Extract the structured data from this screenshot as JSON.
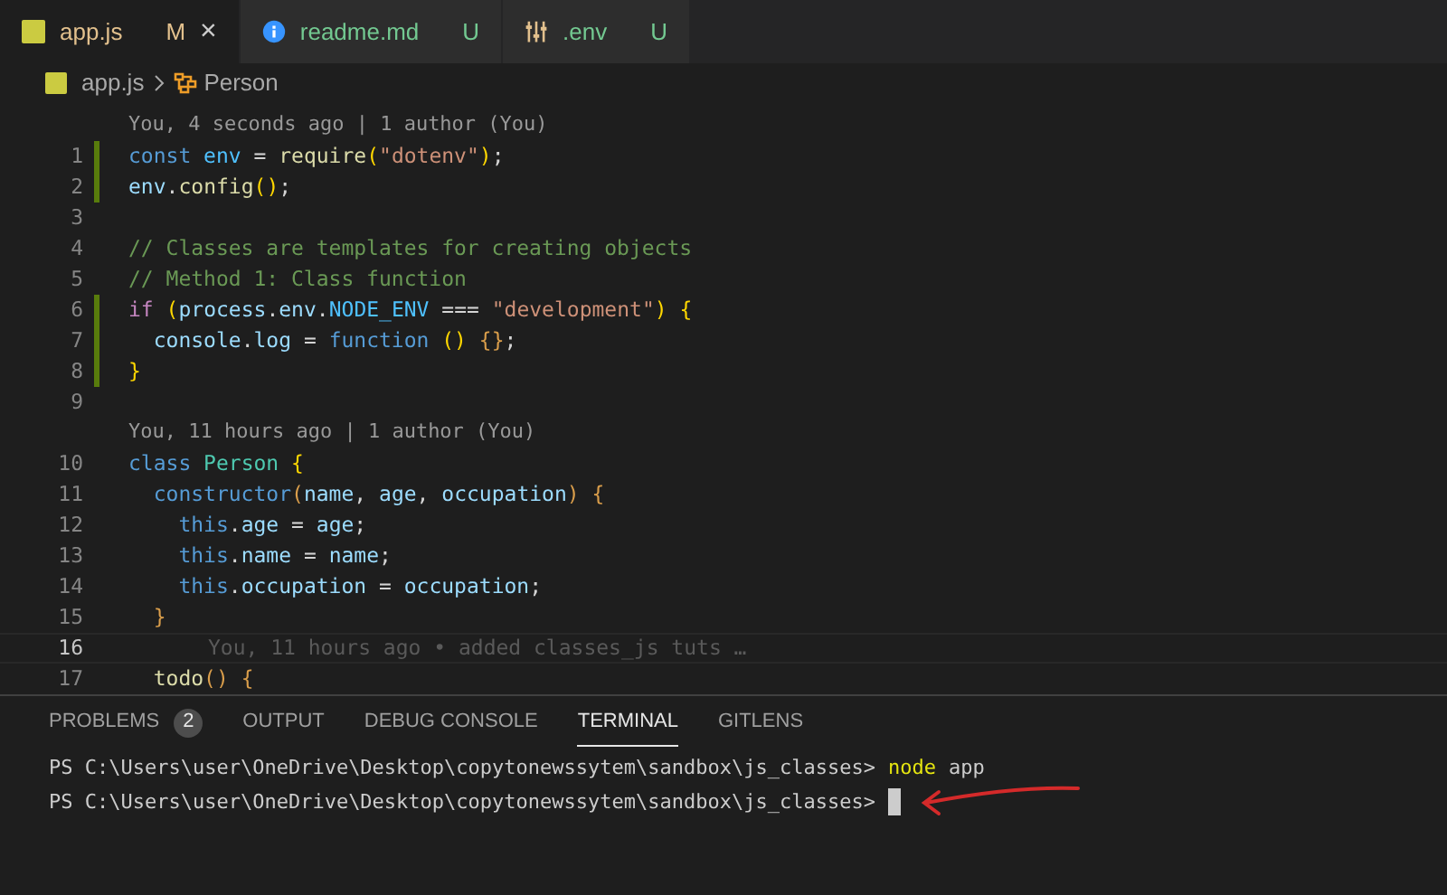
{
  "tabs": [
    {
      "label": "app.js",
      "status": "M",
      "kind": "js",
      "selected": true,
      "close": "×"
    },
    {
      "label": "readme.md",
      "status": "U",
      "kind": "info",
      "selected": false
    },
    {
      "label": ".env",
      "status": "U",
      "kind": "sliders",
      "selected": false
    }
  ],
  "breadcrumb": {
    "file": "app.js",
    "symbol": "Person"
  },
  "editor": {
    "rows": [
      {
        "kind": "codelens",
        "text": "You, 4 seconds ago | 1 author (You)"
      },
      {
        "kind": "code",
        "number": "1",
        "changed": true,
        "current": false,
        "tokens": [
          {
            "t": "const ",
            "kind": "keyword"
          },
          {
            "t": "env",
            "kind": "const"
          },
          {
            "t": " = ",
            "kind": "plain"
          },
          {
            "t": "require",
            "kind": "func"
          },
          {
            "t": "(",
            "kind": "bracket"
          },
          {
            "t": "\"dotenv\"",
            "kind": "string"
          },
          {
            "t": ")",
            "kind": "bracket"
          },
          {
            "t": ";",
            "kind": "plain"
          }
        ]
      },
      {
        "kind": "code",
        "number": "2",
        "changed": true,
        "current": false,
        "tokens": [
          {
            "t": "env",
            "kind": "var"
          },
          {
            "t": ".",
            "kind": "plain"
          },
          {
            "t": "config",
            "kind": "func"
          },
          {
            "t": "()",
            "kind": "bracket"
          },
          {
            "t": ";",
            "kind": "plain"
          }
        ]
      },
      {
        "kind": "code",
        "number": "3",
        "changed": false,
        "current": false,
        "tokens": []
      },
      {
        "kind": "code",
        "number": "4",
        "changed": false,
        "current": false,
        "tokens": [
          {
            "t": "// Classes are templates for creating objects",
            "kind": "comment"
          }
        ]
      },
      {
        "kind": "code",
        "number": "5",
        "changed": false,
        "current": false,
        "tokens": [
          {
            "t": "// Method 1: Class function",
            "kind": "comment"
          }
        ]
      },
      {
        "kind": "code",
        "number": "6",
        "changed": true,
        "current": false,
        "tokens": [
          {
            "t": "if ",
            "kind": "control"
          },
          {
            "t": "(",
            "kind": "bracket"
          },
          {
            "t": "process",
            "kind": "var"
          },
          {
            "t": ".",
            "kind": "plain"
          },
          {
            "t": "env",
            "kind": "var"
          },
          {
            "t": ".",
            "kind": "plain"
          },
          {
            "t": "NODE_ENV",
            "kind": "const"
          },
          {
            "t": " === ",
            "kind": "plain"
          },
          {
            "t": "\"development\"",
            "kind": "string"
          },
          {
            "t": ")",
            "kind": "bracket"
          },
          {
            "t": " {",
            "kind": "bracket"
          }
        ]
      },
      {
        "kind": "code",
        "number": "7",
        "changed": true,
        "current": false,
        "tokens": [
          {
            "t": "  console",
            "kind": "var"
          },
          {
            "t": ".",
            "kind": "plain"
          },
          {
            "t": "log",
            "kind": "var"
          },
          {
            "t": " = ",
            "kind": "plain"
          },
          {
            "t": "function",
            "kind": "keyword"
          },
          {
            "t": " ()",
            "kind": "bracket"
          },
          {
            "t": " {}",
            "kind": "bracket2"
          },
          {
            "t": ";",
            "kind": "plain"
          }
        ]
      },
      {
        "kind": "code",
        "number": "8",
        "changed": true,
        "current": false,
        "tokens": [
          {
            "t": "}",
            "kind": "bracket"
          }
        ]
      },
      {
        "kind": "code",
        "number": "9",
        "changed": false,
        "current": false,
        "tokens": []
      },
      {
        "kind": "codelens",
        "text": "You, 11 hours ago | 1 author (You)"
      },
      {
        "kind": "code",
        "number": "10",
        "changed": false,
        "current": false,
        "tokens": [
          {
            "t": "class ",
            "kind": "keyword"
          },
          {
            "t": "Person",
            "kind": "class"
          },
          {
            "t": " {",
            "kind": "bracket"
          }
        ]
      },
      {
        "kind": "code",
        "number": "11",
        "changed": false,
        "current": false,
        "tokens": [
          {
            "t": "  constructor",
            "kind": "keyword"
          },
          {
            "t": "(",
            "kind": "bracket2"
          },
          {
            "t": "name",
            "kind": "var"
          },
          {
            "t": ", ",
            "kind": "plain"
          },
          {
            "t": "age",
            "kind": "var"
          },
          {
            "t": ", ",
            "kind": "plain"
          },
          {
            "t": "occupation",
            "kind": "var"
          },
          {
            "t": ")",
            "kind": "bracket2"
          },
          {
            "t": " {",
            "kind": "bracket2"
          }
        ]
      },
      {
        "kind": "code",
        "number": "12",
        "changed": false,
        "current": false,
        "tokens": [
          {
            "t": "    this",
            "kind": "keyword"
          },
          {
            "t": ".",
            "kind": "plain"
          },
          {
            "t": "age",
            "kind": "var"
          },
          {
            "t": " = ",
            "kind": "plain"
          },
          {
            "t": "age",
            "kind": "var"
          },
          {
            "t": ";",
            "kind": "plain"
          }
        ]
      },
      {
        "kind": "code",
        "number": "13",
        "changed": false,
        "current": false,
        "tokens": [
          {
            "t": "    this",
            "kind": "keyword"
          },
          {
            "t": ".",
            "kind": "plain"
          },
          {
            "t": "name",
            "kind": "var"
          },
          {
            "t": " = ",
            "kind": "plain"
          },
          {
            "t": "name",
            "kind": "var"
          },
          {
            "t": ";",
            "kind": "plain"
          }
        ]
      },
      {
        "kind": "code",
        "number": "14",
        "changed": false,
        "current": false,
        "tokens": [
          {
            "t": "    this",
            "kind": "keyword"
          },
          {
            "t": ".",
            "kind": "plain"
          },
          {
            "t": "occupation",
            "kind": "var"
          },
          {
            "t": " = ",
            "kind": "plain"
          },
          {
            "t": "occupation",
            "kind": "var"
          },
          {
            "t": ";",
            "kind": "plain"
          }
        ]
      },
      {
        "kind": "code",
        "number": "15",
        "changed": false,
        "current": false,
        "tokens": [
          {
            "t": "  }",
            "kind": "bracket2"
          }
        ]
      },
      {
        "kind": "code",
        "number": "16",
        "changed": false,
        "current": true,
        "tokens": [],
        "blame": "You, 11 hours ago • added classes_js tuts …"
      },
      {
        "kind": "code",
        "number": "17",
        "changed": false,
        "current": false,
        "tokens": [
          {
            "t": "  todo",
            "kind": "func"
          },
          {
            "t": "()",
            "kind": "bracket2"
          },
          {
            "t": " {",
            "kind": "bracket2"
          }
        ]
      }
    ]
  },
  "panel": {
    "tabs": [
      {
        "label": "PROBLEMS",
        "badge": "2",
        "selected": false
      },
      {
        "label": "OUTPUT",
        "selected": false
      },
      {
        "label": "DEBUG CONSOLE",
        "selected": false
      },
      {
        "label": "TERMINAL",
        "selected": true
      },
      {
        "label": "GITLENS",
        "selected": false
      }
    ],
    "terminal": [
      {
        "prompt": "PS C:\\Users\\user\\OneDrive\\Desktop\\copytonewssytem\\sandbox\\js_classes>",
        "command": "node",
        "args": "app",
        "cursor": false
      },
      {
        "prompt": "PS C:\\Users\\user\\OneDrive\\Desktop\\copytonewssytem\\sandbox\\js_classes>",
        "cursor": true
      }
    ]
  }
}
